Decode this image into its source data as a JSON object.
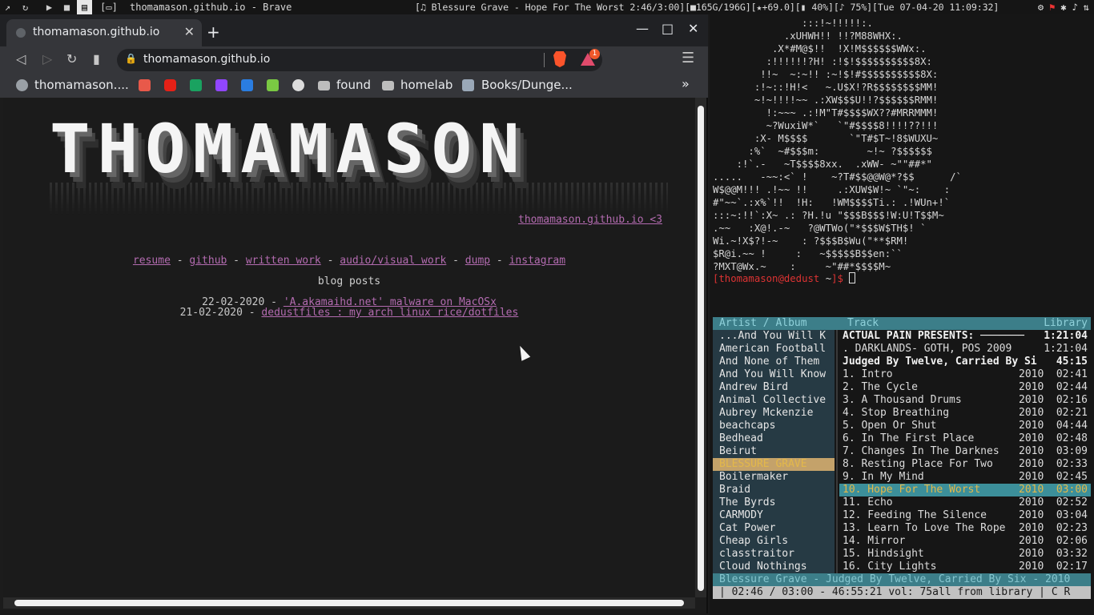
{
  "topbar": {
    "workspaces": [
      "↗",
      "↻",
      "▶",
      "■",
      "▤"
    ],
    "active_workspace": 4,
    "layout": "[▭]",
    "window_title": "thomamason.github.io - Brave",
    "status": "[♫ Blessure Grave - Hope For The Worst 2:46/3:00][■165G/196G][★+69.0][▮ 40%][♪ 75%][Tue 07-04-20 11:09:32]",
    "tray_icons": [
      "steam-icon",
      "red-app-icon",
      "bluetooth-icon",
      "volume-icon",
      "network-icon"
    ]
  },
  "browser": {
    "tab_title": "thomamason.github.io",
    "url": "thomamason.github.io",
    "shields_badge": "1",
    "bookmarks": [
      {
        "label": "thomamason....",
        "icon": "globe-icon"
      },
      {
        "label": "",
        "icon": "inbox-icon"
      },
      {
        "label": "",
        "icon": "youtube-icon"
      },
      {
        "label": "",
        "icon": "sheets-icon"
      },
      {
        "label": "",
        "icon": "twitch-icon"
      },
      {
        "label": "",
        "icon": "trello-icon"
      },
      {
        "label": "",
        "icon": "m-icon"
      },
      {
        "label": "",
        "icon": "github-icon"
      },
      {
        "label": "found",
        "icon": "folder-icon"
      },
      {
        "label": "homelab",
        "icon": "folder-icon"
      },
      {
        "label": "Books/Dunge...",
        "icon": "book-icon"
      }
    ],
    "overflow_label": "»"
  },
  "page": {
    "logo_text": "THOMAMASON",
    "logo_link": "thomamason.github.io <3",
    "links": [
      "resume",
      "github",
      "written work",
      "audio/visual work",
      "dump",
      "instagram"
    ],
    "link_separator": " - ",
    "blog_heading": "blog posts",
    "posts": [
      {
        "date": "22-02-2020",
        "sep": " - ",
        "title": "'A.akamaihd.net' malware on MacOSx"
      },
      {
        "date": "21-02-2020",
        "sep": " - ",
        "title": "dedustfiles : my arch linux rice/dotfiles"
      }
    ]
  },
  "terminal": {
    "ascii_art": "               :::!~!!!!!:.\n            .xUHWH!! !!?M88WHX:.\n          .X*#M@$!!  !X!M$$$$$$WWx:.\n         :!!!!!!?H! :!$!$$$$$$$$$$8X:\n        !!~  ~:~!! :~!$!#$$$$$$$$$$8X:\n       :!~::!H!<   ~.U$X!?R$$$$$$$$MM!\n       ~!~!!!!~~ .:XW$$$U!!?$$$$$$RMM!\n         !:~~~ .:!M\"T#$$$$WX??#MRRMMM!\n         ~?WuxiW*`   `\"#$$$$8!!!!??!!!\n       :X- M$$$$       `\"T#$T~!8$WUXU~\n      :%`  ~#$$$m:        ~!~ ?$$$$$$\n    :!`.-   ~T$$$$8xx.  .xWW- ~\"\"##*\"\n.....   -~~:<` !    ~?T#$$@@W@*?$$      /`\nW$@@M!!! .!~~ !!     .:XUW$W!~ `\"~:    :\n#\"~~`.:x%`!!  !H:   !WM$$$$Ti.: .!WUn+!`\n:::~:!!`:X~ .: ?H.!u \"$$$B$$$!W:U!T$$M~\n.~~   :X@!.-~   ?@WTWo(\"*$$$W$TH$! `\nWi.~!X$?!-~    : ?$$$B$Wu(\"**$RM!\n$R@i.~~ !     :   ~$$$$$B$$en:``\n?MXT@Wx.~    :     ~\"##*$$$$M~",
    "prompt_user": "thomamason",
    "prompt_host": "dedust",
    "prompt_dir": "~"
  },
  "cmus": {
    "header": {
      "artist_album": "Artist / Album",
      "track": "Track",
      "library": "Library"
    },
    "artists": [
      "...And You Will K",
      "American Football",
      "And None of Them",
      "And You Will Know",
      "Andrew Bird",
      "Animal Collective",
      "Aubrey Mckenzie",
      "beachcaps",
      "Bedhead",
      "Beirut",
      "BLESSURE GRAVE",
      "Boilermaker",
      "Braid",
      "The Byrds",
      "CARMODY",
      "Cat Power",
      "Cheap Girls",
      "classtraitor",
      "Cloud Nothings"
    ],
    "selected_artist": 10,
    "tracks": [
      {
        "title": "ACTUAL PAIN PRESENTS: ───────",
        "year": "",
        "dur": "1:21:04",
        "kind": "album"
      },
      {
        "title": " . DARKLANDS- GOTH, POS 2009",
        "year": "",
        "dur": "1:21:04",
        "kind": "track"
      },
      {
        "title": "Judged By Twelve, Carried By Si",
        "year": "",
        "dur": "45:15",
        "kind": "album"
      },
      {
        "title": " 1. Intro",
        "year": "2010",
        "dur": "02:41",
        "kind": "track"
      },
      {
        "title": " 2. The Cycle",
        "year": "2010",
        "dur": "02:44",
        "kind": "track"
      },
      {
        "title": " 3. A Thousand Drums",
        "year": "2010",
        "dur": "02:16",
        "kind": "track"
      },
      {
        "title": " 4. Stop Breathing",
        "year": "2010",
        "dur": "02:21",
        "kind": "track"
      },
      {
        "title": " 5. Open Or Shut",
        "year": "2010",
        "dur": "04:44",
        "kind": "track"
      },
      {
        "title": " 6. In The First Place",
        "year": "2010",
        "dur": "02:48",
        "kind": "track"
      },
      {
        "title": " 7. Changes In The Darknes",
        "year": "2010",
        "dur": "03:09",
        "kind": "track"
      },
      {
        "title": " 8. Resting Place For Two",
        "year": "2010",
        "dur": "02:33",
        "kind": "track"
      },
      {
        "title": " 9. In My Mind",
        "year": "2010",
        "dur": "02:45",
        "kind": "track"
      },
      {
        "title": "10. Hope For The Worst",
        "year": "2010",
        "dur": "03:00",
        "kind": "playing"
      },
      {
        "title": "11. Echo",
        "year": "2010",
        "dur": "02:52",
        "kind": "track"
      },
      {
        "title": "12. Feeding The Silence",
        "year": "2010",
        "dur": "03:04",
        "kind": "track"
      },
      {
        "title": "13. Learn To Love The Rope",
        "year": "2010",
        "dur": "02:23",
        "kind": "track"
      },
      {
        "title": "14. Mirror",
        "year": "2010",
        "dur": "02:06",
        "kind": "track"
      },
      {
        "title": "15. Hindsight",
        "year": "2010",
        "dur": "03:32",
        "kind": "track"
      },
      {
        "title": "16. City Lights",
        "year": "2010",
        "dur": "02:17",
        "kind": "track"
      }
    ],
    "now_playing": "Blessure Grave - Judged By Twelve, Carried By Six -  2010",
    "status": "| 02:46 / 03:00 - 46:55:21 vol: 75all from library | C R"
  }
}
